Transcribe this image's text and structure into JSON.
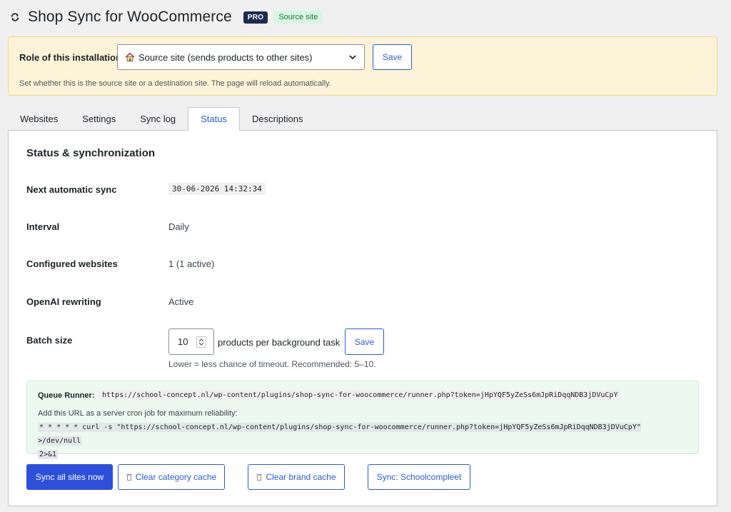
{
  "header": {
    "title": "Shop Sync for WooCommerce",
    "pro_badge": "PRO",
    "site_badge": "Source site"
  },
  "role": {
    "label": "Role of this installation:",
    "selected": "Source site (sends products to other sites)",
    "save_label": "Save",
    "help": "Set whether this is the source site or a destination site. The page will reload automatically."
  },
  "tabs": [
    {
      "label": "Websites",
      "active": false
    },
    {
      "label": "Settings",
      "active": false
    },
    {
      "label": "Sync log",
      "active": false
    },
    {
      "label": "Status",
      "active": true
    },
    {
      "label": "Descriptions",
      "active": false
    }
  ],
  "status": {
    "title": "Status & synchronization",
    "rows": [
      {
        "label": "Next automatic sync",
        "value": "30-06-2026 14:32:34"
      },
      {
        "label": "Interval",
        "value": "Daily"
      },
      {
        "label": "Configured websites",
        "value": "1 (1 active)"
      },
      {
        "label": "OpenAI rewriting",
        "value": "Active"
      }
    ],
    "batch": {
      "label": "Batch size",
      "value": "10",
      "unit": "products per background task",
      "save_label": "Save",
      "help": "Lower = less chance of timeout. Recommended: 5–10."
    }
  },
  "queue": {
    "label": "Queue Runner:",
    "url": "https://school-concept.nl/wp-content/plugins/shop-sync-for-woocommerce/runner.php?token=jHpYQF5yZeSs6mJpRiDqqNDB3jDVuCpY",
    "help": "Add this URL as a server cron job for maximum reliability:",
    "cron_line1": "* * * * * curl -s \"https://school-concept.nl/wp-content/plugins/shop-sync-for-woocommerce/runner.php?token=jHpYQF5yZeSs6mJpRiDqqNDB3jDVuCpY\" >/dev/null",
    "cron_line2": "2>&1"
  },
  "actions": {
    "sync_all": "Sync all sites now",
    "clear_category": "Clear category cache",
    "clear_brand": "Clear brand cache",
    "sync_site": "Sync: Schoolcompleet"
  },
  "colors": {
    "accent": "#2c4fdc",
    "pro_badge_bg": "#1d2a4f",
    "source_badge_bg": "#d8f5e2",
    "role_box_bg": "#fcf3d8",
    "queue_box_bg": "#edf9f0"
  },
  "icons": {
    "header": "sync-icon",
    "role_option": "house-icon",
    "select_caret": "chevron-down-icon",
    "clear_buttons": "trash-icon"
  }
}
